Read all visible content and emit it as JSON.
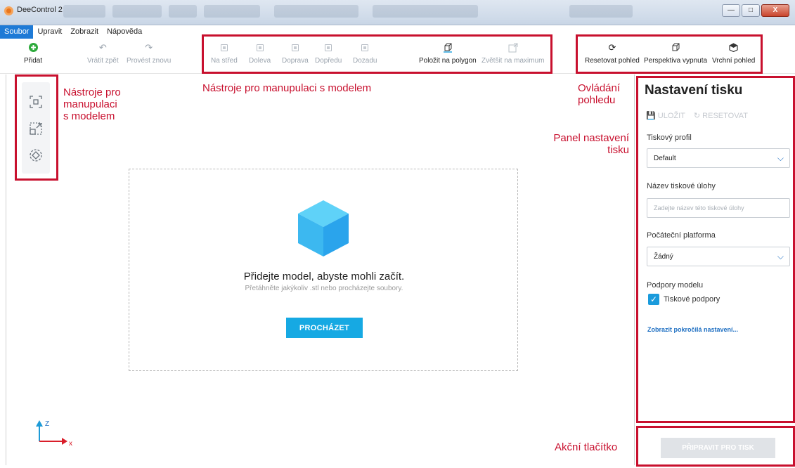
{
  "window": {
    "title": "DeeControl 2",
    "minimize": "—",
    "maximize": "□",
    "close": "X"
  },
  "menu": {
    "items": [
      "Soubor",
      "Upravit",
      "Zobrazit",
      "Nápověda"
    ]
  },
  "toolbar": {
    "add": "Přidat",
    "undo": "Vrátit zpět",
    "redo": "Provést znovu",
    "center": "Na střed",
    "left": "Doleva",
    "right": "Doprava",
    "front": "Dopředu",
    "back": "Dozadu",
    "lay_flat": "Položit na polygon",
    "maximize": "Zvětšit na maximum",
    "reset_view": "Resetovat pohled",
    "perspective": "Perspektiva vypnuta",
    "top_view": "Vrchní pohled"
  },
  "annotations": {
    "left_tools": "Nástroje pro\nmanupulaci\ns modelem",
    "top_tools": "Nástroje pro manupulaci s modelem",
    "view_control": "Ovládání\npohledu",
    "print_panel": "Panel nastavení\ntisku",
    "action_button": "Akční tlačítko"
  },
  "canvas": {
    "drop_title": "Přidejte model, abyste mohli začít.",
    "drop_subtitle": "Přetáhněte jakýkoliv .stl nebo procházejte soubory.",
    "browse_button": "PROCHÁZET",
    "axis_z": "Z",
    "axis_x": "x"
  },
  "panel": {
    "title": "Nastavení tisku",
    "save": "ULOŽIT",
    "reset": "RESETOVAT",
    "profile_label": "Tiskový profil",
    "profile_value": "Default",
    "job_label": "Název tiskové úlohy",
    "job_placeholder": "Zadejte název této tiskové úlohy",
    "platform_label": "Počáteční platforma",
    "platform_value": "Žádný",
    "supports_label": "Podpory modelu",
    "supports_checkbox": "Tiskové podpory",
    "advanced_link": "Zobrazit pokročilá nastavení..."
  },
  "action": {
    "prepare": "PŘIPRAVIT PRO TISK"
  },
  "colors": {
    "accent": "#16a9e3",
    "annotation": "#c8102e",
    "link": "#1e6fc2",
    "cube": "#3cb8f0"
  }
}
